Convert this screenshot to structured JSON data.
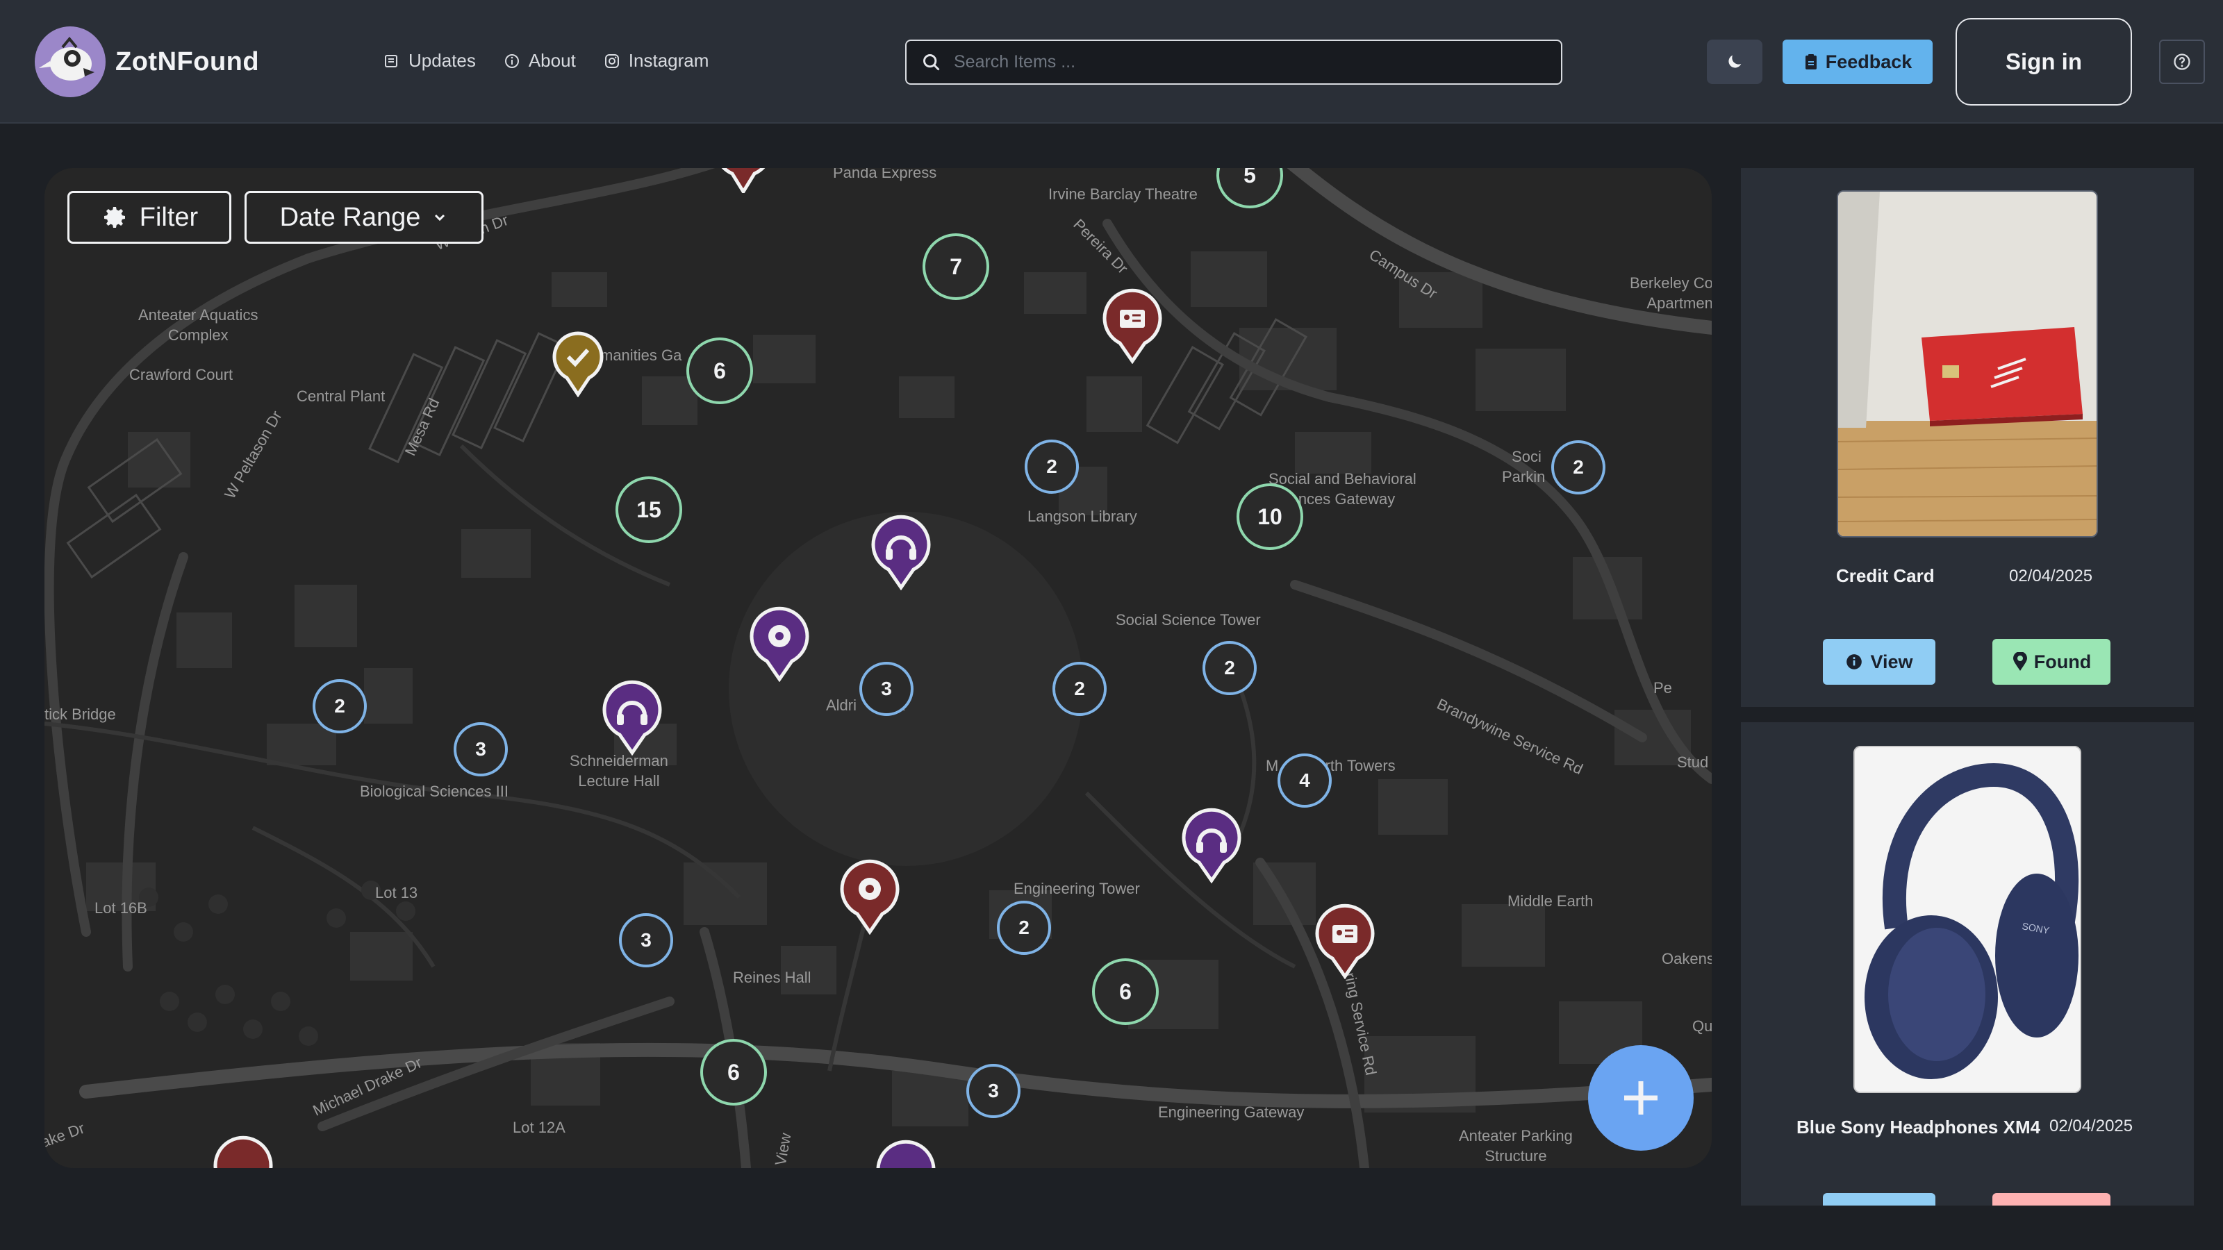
{
  "header": {
    "brand": "ZotNFound",
    "nav": [
      {
        "label": "Updates",
        "icon": "newspaper-icon"
      },
      {
        "label": "About",
        "icon": "info-icon"
      },
      {
        "label": "Instagram",
        "icon": "instagram-icon"
      }
    ],
    "search_placeholder": "Search Items ...",
    "feedback_label": "Feedback",
    "signin_label": "Sign in"
  },
  "map": {
    "filter_label": "Filter",
    "date_range_label": "Date Range",
    "places": {
      "panda": "Panda Express",
      "barclay": "Irvine Barclay Theatre",
      "berkeley": "Berkeley Co\nApartmen",
      "aquatics": "Anteater Aquatics\nComplex",
      "crawford": "Crawford Court",
      "central_plant": "Central Plant",
      "humanities": "manities Ga",
      "langson": "Langson Library",
      "sbs_gateway": "Social and Behavioral\nences Gateway",
      "social_parking": "Soci        ce\nParkin        ure",
      "ss_tower": "Social Science Tower",
      "tick_bridge": "tick Bridge",
      "aldrich": "Aldri    Park",
      "schneiderman": "Schneiderman\nLecture Hall",
      "bio_sci": "Biological Sciences III",
      "middle_earth_towers": "M         arth Towers",
      "pe": "Pe",
      "stud": "Stud",
      "lot16b": "Lot 16B",
      "lot13": "Lot 13",
      "eng_tower": "Engineering Tower",
      "middle_earth": "Middle Earth",
      "oakens": "Oakens",
      "reines": "Reines Hall",
      "qu": "Qu",
      "eng_gateway": "Engineering Gateway",
      "anteater_parking": "Anteater Parking\nStructure",
      "lot12a": "Lot 12A"
    },
    "roads": {
      "peltason_top": "W        tason Dr",
      "peltason_left": "W Peltason Dr",
      "campus": "Campus Dr",
      "pereira": "Pereira Dr",
      "mesa": "Mesa Rd",
      "brandywine": "Brandywine Service Rd",
      "eng_service": "Engineering Service Rd",
      "michael_drake": "Michael Drake Dr",
      "lake": "ake Dr",
      "view": "View"
    },
    "clusters": [
      {
        "count": "5",
        "color": "green"
      },
      {
        "count": "7",
        "color": "green"
      },
      {
        "count": "6",
        "color": "green"
      },
      {
        "count": "15",
        "color": "green"
      },
      {
        "count": "2",
        "color": "blue"
      },
      {
        "count": "10",
        "color": "green"
      },
      {
        "count": "2",
        "color": "blue"
      },
      {
        "count": "2",
        "color": "blue"
      },
      {
        "count": "3",
        "color": "blue"
      },
      {
        "count": "3",
        "color": "blue"
      },
      {
        "count": "2",
        "color": "blue"
      },
      {
        "count": "2",
        "color": "blue"
      },
      {
        "count": "4",
        "color": "blue"
      },
      {
        "count": "3",
        "color": "blue"
      },
      {
        "count": "2",
        "color": "blue"
      },
      {
        "count": "6",
        "color": "green"
      },
      {
        "count": "6",
        "color": "green"
      },
      {
        "count": "3",
        "color": "blue"
      }
    ]
  },
  "items": [
    {
      "title": "Credit Card",
      "date": "02/04/2025",
      "view_label": "View",
      "status_label": "Found"
    },
    {
      "title": "Blue Sony Headphones XM4",
      "date": "02/04/2025"
    }
  ],
  "colors": {
    "accent_blue": "#63b3ed",
    "found_green": "#9ae6b4",
    "pin_red": "#7a2a2a",
    "pin_purple": "#5a2d82",
    "pin_gold": "#8a6d1f",
    "fab": "#6aa4f2"
  }
}
